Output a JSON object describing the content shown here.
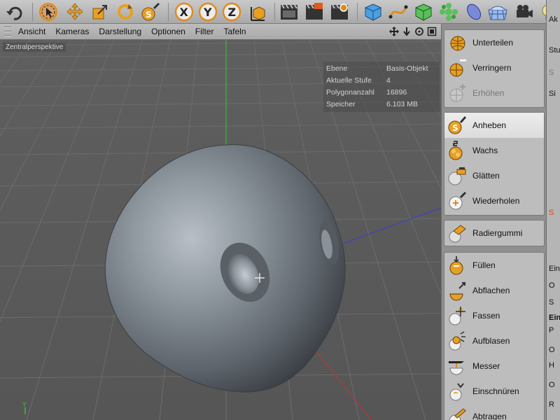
{
  "toolbar": {
    "icons": [
      "undo-icon",
      "select-icon",
      "move-icon",
      "scale-icon",
      "rotate-icon",
      "sculpt-brush-icon",
      "x-axis-icon",
      "y-axis-icon",
      "z-axis-icon",
      "coordinate-system-icon",
      "render-view-icon",
      "render-picture-viewer-icon",
      "render-settings-icon",
      "cube-icon",
      "spline-icon",
      "nurbs-icon",
      "array-icon",
      "deformer-icon",
      "environment-icon",
      "camera-icon",
      "light-icon"
    ],
    "axis_labels": {
      "x": "X",
      "y": "Y",
      "z": "Z"
    }
  },
  "viewport": {
    "menu": [
      "Ansicht",
      "Kameras",
      "Darstellung",
      "Optionen",
      "Filter",
      "Tafeln"
    ],
    "label": "Zentralperspektive",
    "stats": [
      {
        "label": "Ebene",
        "value": "Basis-Objekt"
      },
      {
        "label": "Aktuelle Stufe",
        "value": "4"
      },
      {
        "label": "Polygonanzahl",
        "value": "16896"
      },
      {
        "label": "Speicher",
        "value": "6.103 MB"
      }
    ],
    "axis_y_label": "Y"
  },
  "palette": {
    "groups": [
      {
        "tools": [
          {
            "label": "Unterteilen",
            "icon": "subdivide-icon",
            "state": "normal"
          },
          {
            "label": "Verringern",
            "icon": "decrease-icon",
            "state": "normal"
          },
          {
            "label": "Erhöhen",
            "icon": "increase-icon",
            "state": "disabled"
          }
        ]
      },
      {
        "tools": [
          {
            "label": "Anheben",
            "icon": "pull-brush-icon",
            "state": "active"
          },
          {
            "label": "Wachs",
            "icon": "wax-brush-icon",
            "state": "normal"
          },
          {
            "label": "Glätten",
            "icon": "smooth-brush-icon",
            "state": "normal"
          },
          {
            "label": "Wiederholen",
            "icon": "repeat-brush-icon",
            "state": "normal"
          }
        ]
      },
      {
        "tools": [
          {
            "label": "Radiergummi",
            "icon": "erase-brush-icon",
            "state": "normal"
          }
        ]
      },
      {
        "tools": [
          {
            "label": "Füllen",
            "icon": "fill-brush-icon",
            "state": "normal"
          },
          {
            "label": "Abflachen",
            "icon": "flatten-brush-icon",
            "state": "normal"
          },
          {
            "label": "Fassen",
            "icon": "grab-brush-icon",
            "state": "normal"
          },
          {
            "label": "Aufblasen",
            "icon": "inflate-brush-icon",
            "state": "normal"
          },
          {
            "label": "Messer",
            "icon": "knife-brush-icon",
            "state": "normal"
          },
          {
            "label": "Einschnüren",
            "icon": "pinch-brush-icon",
            "state": "normal"
          },
          {
            "label": "Abtragen",
            "icon": "scrape-brush-icon",
            "state": "normal"
          }
        ]
      }
    ]
  },
  "right_panel": {
    "texts": [
      "Ak",
      "Stu",
      "S",
      "Si",
      "S",
      "Ein",
      "O",
      "S",
      "Ein",
      "P",
      "O",
      "H",
      "O",
      "R"
    ]
  },
  "colors": {
    "accent_orange": "#e08a1e",
    "axis_y": "#3cc03c",
    "axis_x": "#c83232",
    "axis_z": "#3232c8",
    "active_tool_bg": "#e6e6e6"
  }
}
